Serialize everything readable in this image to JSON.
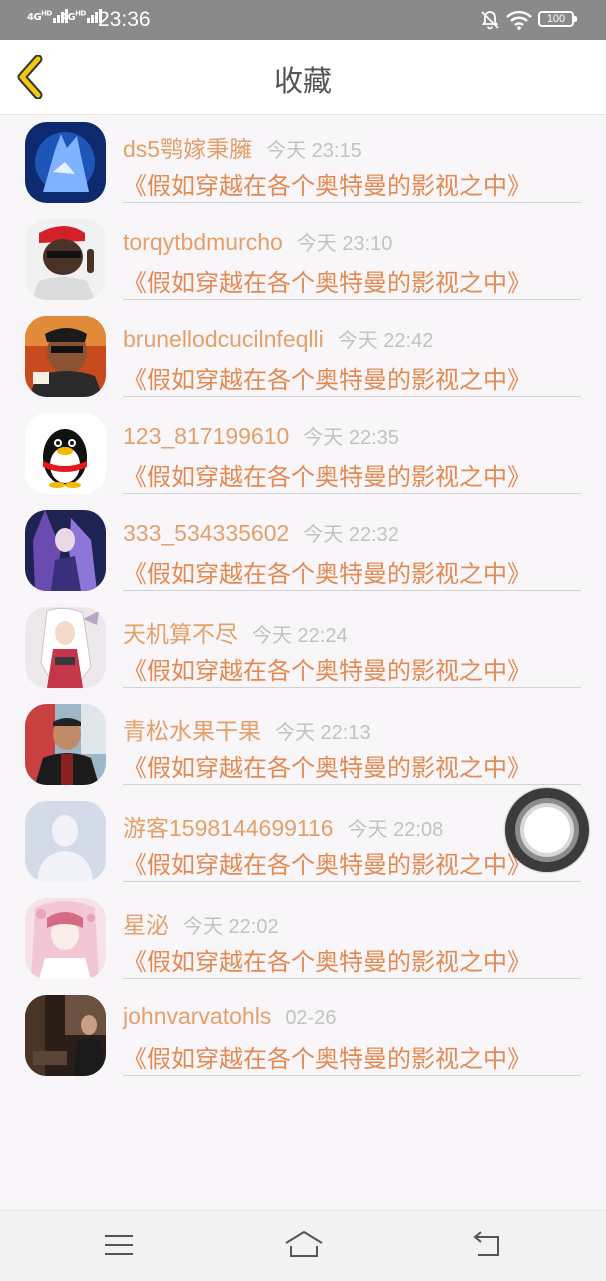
{
  "status_bar": {
    "signal1": "4G",
    "signal1_sup": "HD",
    "signal2": "4G",
    "signal2_sup": "HD",
    "time": "23:36",
    "battery": "100"
  },
  "header": {
    "title": "收藏",
    "back_icon": "chevron-left-icon",
    "accent": "#f2c811"
  },
  "favorites": [
    {
      "user": "ds5鹗嫁秉臃",
      "time": "今天 23:15",
      "book": "《假如穿越在各个奥特曼的影视之中》",
      "avatar": "wolf-avatar"
    },
    {
      "user": "torqytbdmurcho",
      "time": "今天 23:10",
      "book": "《假如穿越在各个奥特曼的影视之中》",
      "avatar": "man-red-cap-avatar"
    },
    {
      "user": "brunellodcucilnfeqlli",
      "time": "今天 22:42",
      "book": "《假如穿越在各个奥特曼的影视之中》",
      "avatar": "man-sunglasses-avatar"
    },
    {
      "user": "123_817199610",
      "time": "今天 22:35",
      "book": "《假如穿越在各个奥特曼的影视之中》",
      "avatar": "penguin-avatar"
    },
    {
      "user": "333_534335602",
      "time": "今天 22:32",
      "book": "《假如穿越在各个奥特曼的影视之中》",
      "avatar": "anime-purple-avatar"
    },
    {
      "user": "天机算不尽",
      "time": "今天 22:24",
      "book": "《假如穿越在各个奥特曼的影视之中》",
      "avatar": "anime-white-hair-avatar"
    },
    {
      "user": "青松水果干果",
      "time": "今天 22:13",
      "book": "《假如穿越在各个奥特曼的影视之中》",
      "avatar": "man-photo-avatar"
    },
    {
      "user": "游客1598144699116",
      "time": "今天 22:08",
      "book": "《假如穿越在各个奥特曼的影视之中》",
      "avatar": "default-user-avatar"
    },
    {
      "user": "星泌",
      "time": "今天 22:02",
      "book": "《假如穿越在各个奥特曼的影视之中》",
      "avatar": "anime-girl-avatar"
    },
    {
      "user": "johnvarvatohls",
      "time": "02-26",
      "book": "《假如穿越在各个奥特曼的影视之中》",
      "avatar": "man-dark-photo-avatar"
    }
  ],
  "colors": {
    "username": "#e4a06a",
    "book_title": "#e38a52",
    "time": "#c2c2c2"
  },
  "nav_bar": {
    "menu_icon": "menu-icon",
    "home_icon": "home-icon",
    "back_icon": "back-icon"
  },
  "floating_button": {
    "icon": "assistive-touch-icon"
  }
}
